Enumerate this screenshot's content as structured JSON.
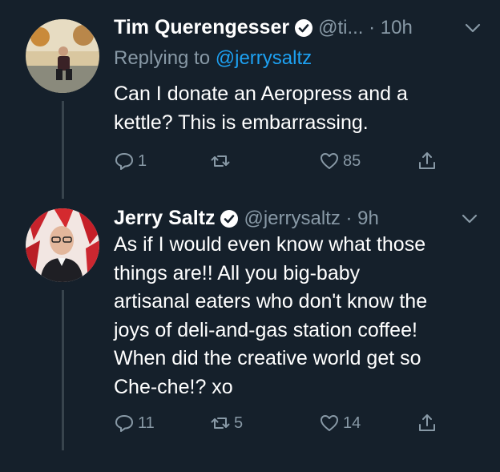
{
  "colors": {
    "background": "#15202b",
    "text": "#ffffff",
    "muted": "#8899a6",
    "link": "#1da1f2",
    "thread_line": "#38444d"
  },
  "tweets": [
    {
      "author_name": "Tim Querengesser",
      "handle_time": "@ti... · 10h",
      "reply_prefix": "Replying to ",
      "reply_to": "@jerrysaltz",
      "text": "Can I donate an Aeropress and a\nkettle? This is embarrassing.",
      "replies": "1",
      "retweets": "",
      "likes": "85",
      "icons": [
        "reply-icon",
        "retweet-icon",
        "heart-icon",
        "share-icon"
      ]
    },
    {
      "author_name": "Jerry Saltz",
      "handle_time": "@jerrysaltz · 9h",
      "text": "As if I would even know what those\nthings are!! All you big-baby\nartisanal eaters who don't know the\njoys of deli-and-gas station coffee!\nWhen did the creative world get so\nChe-che!?  xo",
      "replies": "11",
      "retweets": "5",
      "likes": "14",
      "icons": [
        "reply-icon",
        "retweet-icon",
        "heart-icon",
        "share-icon"
      ]
    }
  ]
}
